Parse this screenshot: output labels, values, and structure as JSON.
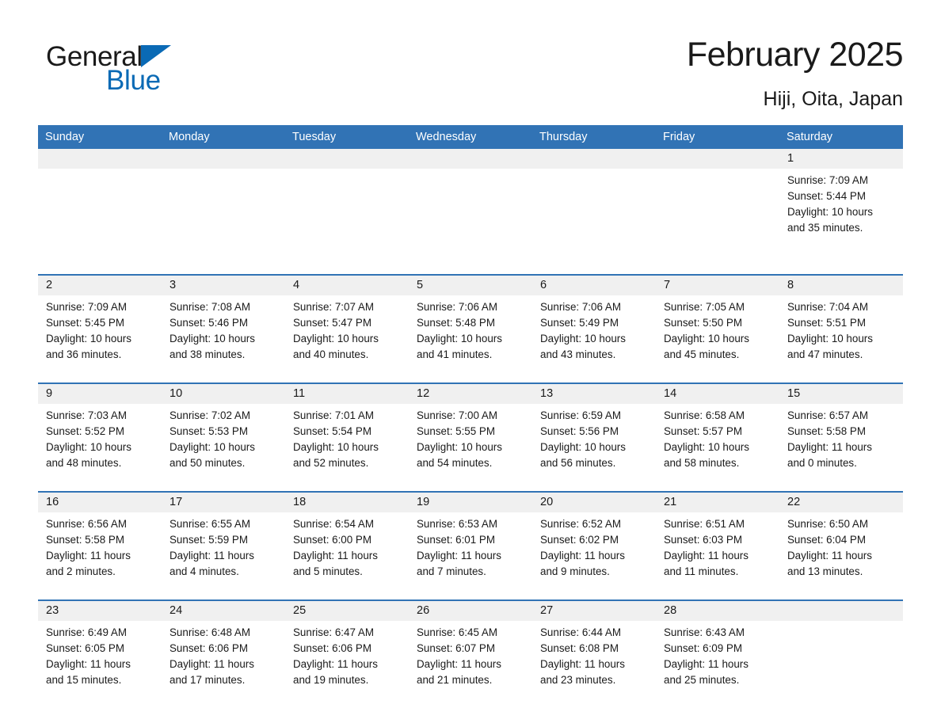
{
  "brand": {
    "name_part1": "General",
    "name_part2": "Blue",
    "triangle_color": "#0a6ab5"
  },
  "header": {
    "title": "February 2025",
    "location": "Hiji, Oita, Japan"
  },
  "theme": {
    "header_blue": "#3173b5",
    "date_band_gray": "#f0f0f0",
    "text_color": "#1a1a1a"
  },
  "weekdays": [
    "Sunday",
    "Monday",
    "Tuesday",
    "Wednesday",
    "Thursday",
    "Friday",
    "Saturday"
  ],
  "weeks": [
    [
      {
        "day": "",
        "lines": []
      },
      {
        "day": "",
        "lines": []
      },
      {
        "day": "",
        "lines": []
      },
      {
        "day": "",
        "lines": []
      },
      {
        "day": "",
        "lines": []
      },
      {
        "day": "",
        "lines": []
      },
      {
        "day": "1",
        "lines": [
          "Sunrise: 7:09 AM",
          "Sunset: 5:44 PM",
          "Daylight: 10 hours",
          "and 35 minutes."
        ]
      }
    ],
    [
      {
        "day": "2",
        "lines": [
          "Sunrise: 7:09 AM",
          "Sunset: 5:45 PM",
          "Daylight: 10 hours",
          "and 36 minutes."
        ]
      },
      {
        "day": "3",
        "lines": [
          "Sunrise: 7:08 AM",
          "Sunset: 5:46 PM",
          "Daylight: 10 hours",
          "and 38 minutes."
        ]
      },
      {
        "day": "4",
        "lines": [
          "Sunrise: 7:07 AM",
          "Sunset: 5:47 PM",
          "Daylight: 10 hours",
          "and 40 minutes."
        ]
      },
      {
        "day": "5",
        "lines": [
          "Sunrise: 7:06 AM",
          "Sunset: 5:48 PM",
          "Daylight: 10 hours",
          "and 41 minutes."
        ]
      },
      {
        "day": "6",
        "lines": [
          "Sunrise: 7:06 AM",
          "Sunset: 5:49 PM",
          "Daylight: 10 hours",
          "and 43 minutes."
        ]
      },
      {
        "day": "7",
        "lines": [
          "Sunrise: 7:05 AM",
          "Sunset: 5:50 PM",
          "Daylight: 10 hours",
          "and 45 minutes."
        ]
      },
      {
        "day": "8",
        "lines": [
          "Sunrise: 7:04 AM",
          "Sunset: 5:51 PM",
          "Daylight: 10 hours",
          "and 47 minutes."
        ]
      }
    ],
    [
      {
        "day": "9",
        "lines": [
          "Sunrise: 7:03 AM",
          "Sunset: 5:52 PM",
          "Daylight: 10 hours",
          "and 48 minutes."
        ]
      },
      {
        "day": "10",
        "lines": [
          "Sunrise: 7:02 AM",
          "Sunset: 5:53 PM",
          "Daylight: 10 hours",
          "and 50 minutes."
        ]
      },
      {
        "day": "11",
        "lines": [
          "Sunrise: 7:01 AM",
          "Sunset: 5:54 PM",
          "Daylight: 10 hours",
          "and 52 minutes."
        ]
      },
      {
        "day": "12",
        "lines": [
          "Sunrise: 7:00 AM",
          "Sunset: 5:55 PM",
          "Daylight: 10 hours",
          "and 54 minutes."
        ]
      },
      {
        "day": "13",
        "lines": [
          "Sunrise: 6:59 AM",
          "Sunset: 5:56 PM",
          "Daylight: 10 hours",
          "and 56 minutes."
        ]
      },
      {
        "day": "14",
        "lines": [
          "Sunrise: 6:58 AM",
          "Sunset: 5:57 PM",
          "Daylight: 10 hours",
          "and 58 minutes."
        ]
      },
      {
        "day": "15",
        "lines": [
          "Sunrise: 6:57 AM",
          "Sunset: 5:58 PM",
          "Daylight: 11 hours",
          "and 0 minutes."
        ]
      }
    ],
    [
      {
        "day": "16",
        "lines": [
          "Sunrise: 6:56 AM",
          "Sunset: 5:58 PM",
          "Daylight: 11 hours",
          "and 2 minutes."
        ]
      },
      {
        "day": "17",
        "lines": [
          "Sunrise: 6:55 AM",
          "Sunset: 5:59 PM",
          "Daylight: 11 hours",
          "and 4 minutes."
        ]
      },
      {
        "day": "18",
        "lines": [
          "Sunrise: 6:54 AM",
          "Sunset: 6:00 PM",
          "Daylight: 11 hours",
          "and 5 minutes."
        ]
      },
      {
        "day": "19",
        "lines": [
          "Sunrise: 6:53 AM",
          "Sunset: 6:01 PM",
          "Daylight: 11 hours",
          "and 7 minutes."
        ]
      },
      {
        "day": "20",
        "lines": [
          "Sunrise: 6:52 AM",
          "Sunset: 6:02 PM",
          "Daylight: 11 hours",
          "and 9 minutes."
        ]
      },
      {
        "day": "21",
        "lines": [
          "Sunrise: 6:51 AM",
          "Sunset: 6:03 PM",
          "Daylight: 11 hours",
          "and 11 minutes."
        ]
      },
      {
        "day": "22",
        "lines": [
          "Sunrise: 6:50 AM",
          "Sunset: 6:04 PM",
          "Daylight: 11 hours",
          "and 13 minutes."
        ]
      }
    ],
    [
      {
        "day": "23",
        "lines": [
          "Sunrise: 6:49 AM",
          "Sunset: 6:05 PM",
          "Daylight: 11 hours",
          "and 15 minutes."
        ]
      },
      {
        "day": "24",
        "lines": [
          "Sunrise: 6:48 AM",
          "Sunset: 6:06 PM",
          "Daylight: 11 hours",
          "and 17 minutes."
        ]
      },
      {
        "day": "25",
        "lines": [
          "Sunrise: 6:47 AM",
          "Sunset: 6:06 PM",
          "Daylight: 11 hours",
          "and 19 minutes."
        ]
      },
      {
        "day": "26",
        "lines": [
          "Sunrise: 6:45 AM",
          "Sunset: 6:07 PM",
          "Daylight: 11 hours",
          "and 21 minutes."
        ]
      },
      {
        "day": "27",
        "lines": [
          "Sunrise: 6:44 AM",
          "Sunset: 6:08 PM",
          "Daylight: 11 hours",
          "and 23 minutes."
        ]
      },
      {
        "day": "28",
        "lines": [
          "Sunrise: 6:43 AM",
          "Sunset: 6:09 PM",
          "Daylight: 11 hours",
          "and 25 minutes."
        ]
      },
      {
        "day": "",
        "lines": []
      }
    ]
  ]
}
